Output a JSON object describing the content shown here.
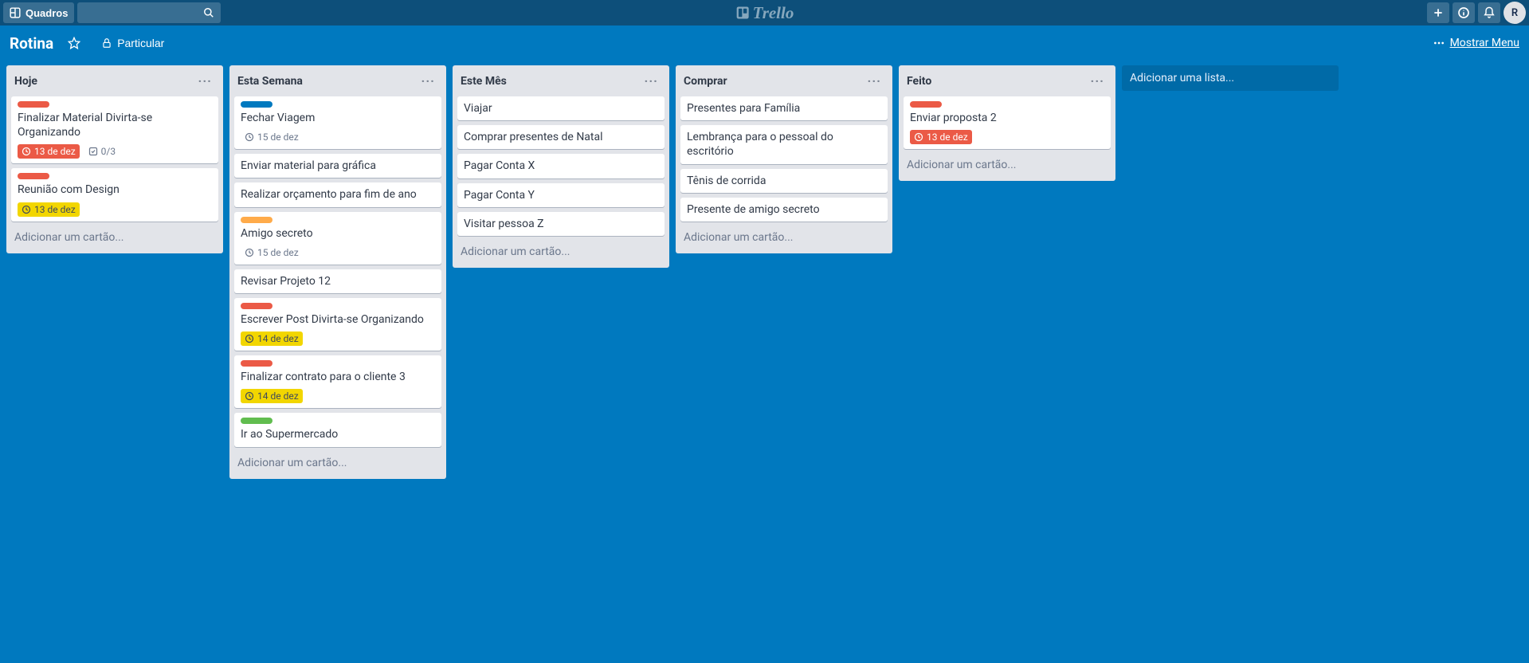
{
  "header": {
    "boards_label": "Quadros",
    "logo_text": "Trello",
    "avatar_initial": "R"
  },
  "board_bar": {
    "title": "Rotina",
    "visibility_label": "Particular",
    "show_menu_label": "Mostrar Menu"
  },
  "add_list_label": "Adicionar uma lista...",
  "add_card_label": "Adicionar um cartão...",
  "lists": [
    {
      "title": "Hoje",
      "cards": [
        {
          "labels": [
            "red"
          ],
          "title": "Finalizar Material Divirta-se Organizando",
          "due": {
            "text": "13 de dez",
            "style": "red"
          },
          "checklist": "0/3"
        },
        {
          "labels": [
            "red"
          ],
          "title": "Reunião com Design",
          "due": {
            "text": "13 de dez",
            "style": "yellow"
          }
        }
      ]
    },
    {
      "title": "Esta Semana",
      "cards": [
        {
          "labels": [
            "blue"
          ],
          "title": "Fechar Viagem",
          "due": {
            "text": "15 de dez",
            "style": "plain"
          }
        },
        {
          "title": "Enviar material para gráfica"
        },
        {
          "title": "Realizar orçamento para fim de ano"
        },
        {
          "labels": [
            "orange"
          ],
          "title": "Amigo secreto",
          "due": {
            "text": "15 de dez",
            "style": "plain"
          }
        },
        {
          "title": "Revisar Projeto 12"
        },
        {
          "labels": [
            "red"
          ],
          "title": "Escrever Post Divirta-se Organizando",
          "due": {
            "text": "14 de dez",
            "style": "yellow"
          }
        },
        {
          "labels": [
            "red"
          ],
          "title": "Finalizar contrato para o cliente 3",
          "due": {
            "text": "14 de dez",
            "style": "yellow"
          }
        },
        {
          "labels": [
            "green"
          ],
          "title": "Ir ao Supermercado"
        }
      ]
    },
    {
      "title": "Este Mês",
      "cards": [
        {
          "title": "Viajar"
        },
        {
          "title": "Comprar presentes de Natal"
        },
        {
          "title": "Pagar Conta X"
        },
        {
          "title": "Pagar Conta Y"
        },
        {
          "title": "Visitar pessoa Z"
        }
      ]
    },
    {
      "title": "Comprar",
      "cards": [
        {
          "title": "Presentes para Família"
        },
        {
          "title": "Lembrança para o pessoal do escritório"
        },
        {
          "title": "Tênis de corrida"
        },
        {
          "title": "Presente de amigo secreto"
        }
      ]
    },
    {
      "title": "Feito",
      "cards": [
        {
          "labels": [
            "red"
          ],
          "title": "Enviar proposta 2",
          "due": {
            "text": "13 de dez",
            "style": "red"
          }
        }
      ]
    }
  ]
}
